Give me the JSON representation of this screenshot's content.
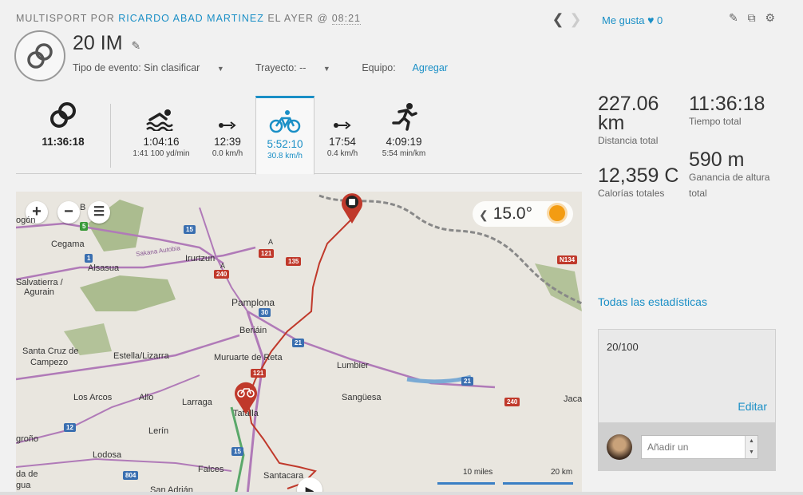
{
  "header": {
    "prefix": "MULTISPORT POR",
    "author": "RICARDO ABAD MARTINEZ",
    "when": "EL AYER @",
    "time": "08:21",
    "like_label": "Me gusta",
    "like_count": "0"
  },
  "activity": {
    "title": "20 IM",
    "event_type_label": "Tipo de evento: Sin clasificar",
    "route_label": "Trayecto: --",
    "team_label": "Equipo:",
    "team_link": "Agregar"
  },
  "legs": [
    {
      "name": "total",
      "main": "11:36:18",
      "sub": "",
      "icon": "multisport-rings-icon"
    },
    {
      "name": "swim",
      "main": "1:04:16",
      "sub": "1:41 100 yd/min",
      "icon": "swim-icon"
    },
    {
      "name": "transition-1",
      "main": "12:39",
      "sub": "0.0 km/h",
      "icon": "transition-icon"
    },
    {
      "name": "bike",
      "main": "5:52:10",
      "sub": "30.8 km/h",
      "icon": "bike-icon"
    },
    {
      "name": "transition-2",
      "main": "17:54",
      "sub": "0.4 km/h",
      "icon": "transition-icon"
    },
    {
      "name": "run",
      "main": "4:09:19",
      "sub": "5:54 min/km",
      "icon": "run-icon"
    }
  ],
  "stats": {
    "distance_value": "227.06",
    "distance_unit": "km",
    "distance_label": "Distancia total",
    "time_value": "11:36:18",
    "time_label": "Tiempo total",
    "calories_value": "12,359 C",
    "calories_label": "Calorías totales",
    "elevation_value": "590 m",
    "elevation_label": "Ganancia de altura total"
  },
  "map": {
    "weather_temp": "15.0°",
    "places": {
      "cegama": "Cegama",
      "alsasua": "Alsasua",
      "irurtzun": "Irurtzun",
      "salvatierra": "Salvatierra /",
      "agurain": "Agurain",
      "pamplona": "Pamplona",
      "beriain": "Beriáin",
      "santa_cruz": "Santa Cruz de",
      "campezo": "Campezo",
      "estella": "Estella/Lizarra",
      "muruarte": "Muruarte de Reta",
      "lumbier": "Lumbier",
      "los_arcos": "Los Arcos",
      "allo": "Allo",
      "larraga": "Larraga",
      "tafalla": "Tafalla",
      "sanguesa": "Sangüesa",
      "jaca": "Jaca",
      "lerin": "Lerín",
      "logrono": "groño",
      "lodosa": "Lodosa",
      "falces": "Falces",
      "santacara": "Santacara",
      "san_adrian": "San Adrián",
      "oyon": "da de",
      "agua": "gua",
      "autopista": "Sakana Autobia",
      "ogon": "ogón",
      "b": "B",
      "a1": "A",
      "a2": "A"
    },
    "roads": [
      "5",
      "15",
      "121",
      "135",
      "240",
      "30",
      "21",
      "12",
      "15",
      "804",
      "21",
      "240",
      "N134",
      "1",
      "121"
    ],
    "scale_miles": "10 miles",
    "scale_km": "20 km"
  },
  "sidebar": {
    "all_stats_link": "Todas las estadísticas",
    "note_text": "20/100",
    "edit_link": "Editar",
    "comment_placeholder": "Añadir un"
  },
  "colors": {
    "accent": "#1a8fc6",
    "route": "#c0392b"
  }
}
